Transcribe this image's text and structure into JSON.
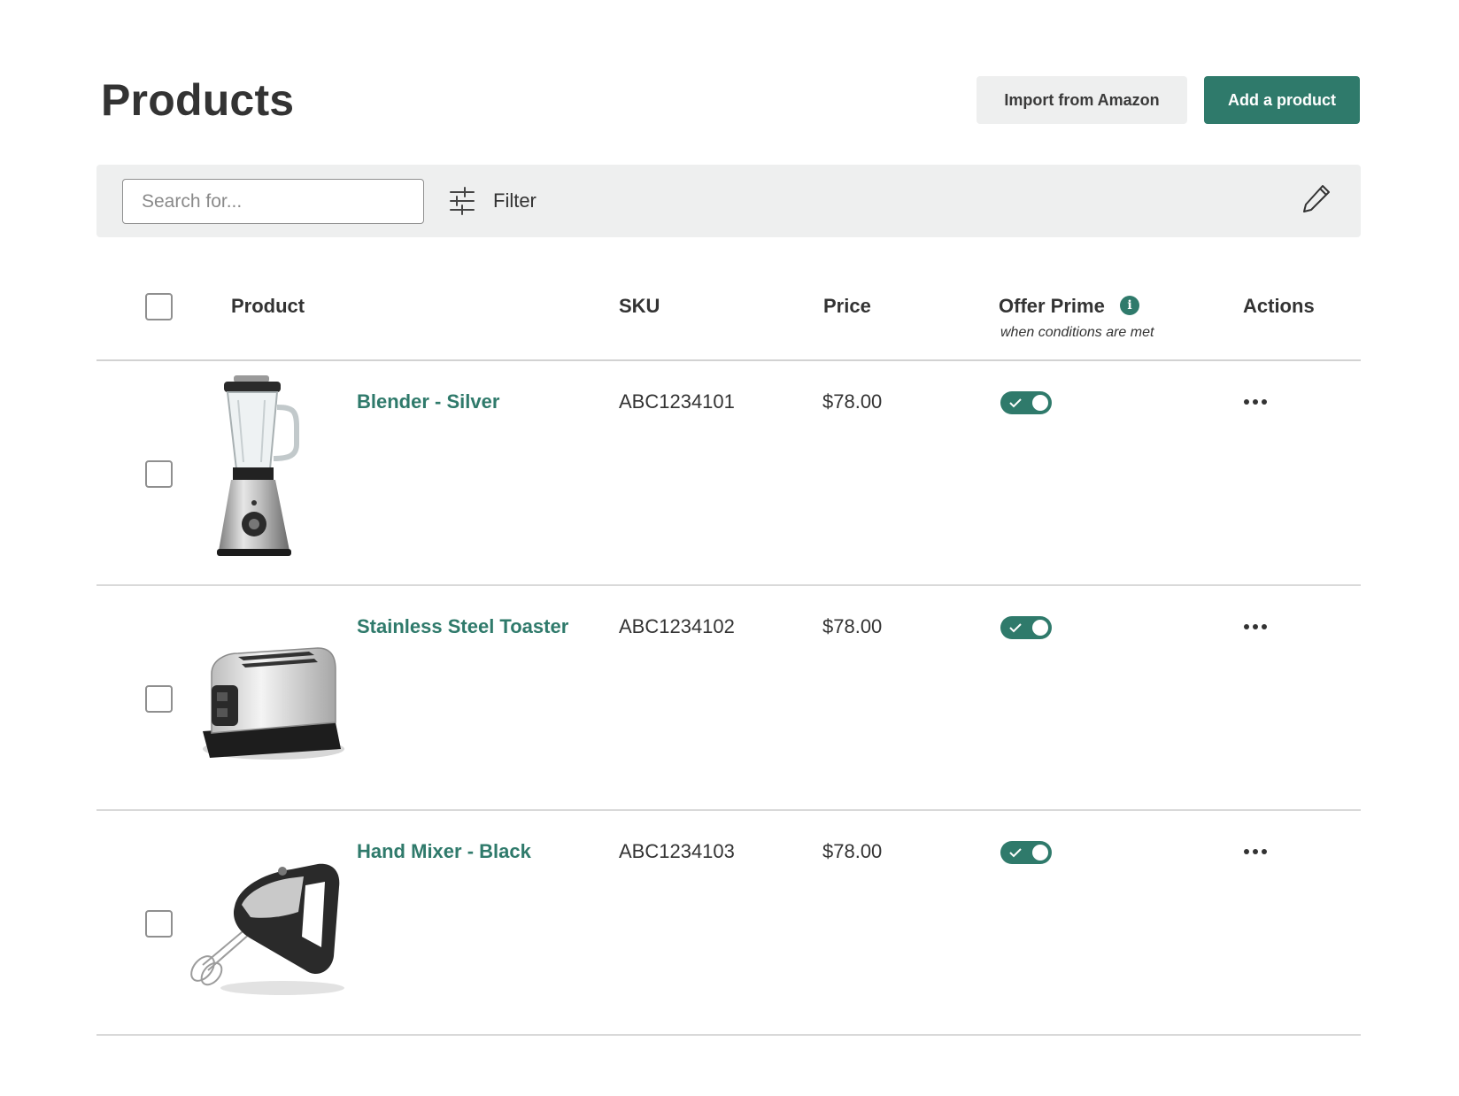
{
  "header": {
    "title": "Products",
    "import_label": "Import from Amazon",
    "add_label": "Add a product"
  },
  "colors": {
    "accent": "#2f7a6b",
    "toolbar_bg": "#eeefef",
    "secondary_button_bg": "#eeefef"
  },
  "toolbar": {
    "search_placeholder": "Search for...",
    "filter_label": "Filter",
    "filter_icon": "sliders-icon",
    "edit_icon": "pencil-icon"
  },
  "table": {
    "columns": {
      "product": "Product",
      "sku": "SKU",
      "price": "Price",
      "offer_prime": "Offer Prime",
      "offer_prime_sub": "when conditions are met",
      "actions": "Actions"
    },
    "rows": [
      {
        "name": "Blender - Silver",
        "sku": "ABC1234101",
        "price": "$78.00",
        "offer_prime": true,
        "image_icon": "blender-image"
      },
      {
        "name": "Stainless Steel Toaster",
        "sku": "ABC1234102",
        "price": "$78.00",
        "offer_prime": true,
        "image_icon": "toaster-image"
      },
      {
        "name": "Hand Mixer - Black",
        "sku": "ABC1234103",
        "price": "$78.00",
        "offer_prime": true,
        "image_icon": "hand-mixer-image"
      }
    ]
  }
}
